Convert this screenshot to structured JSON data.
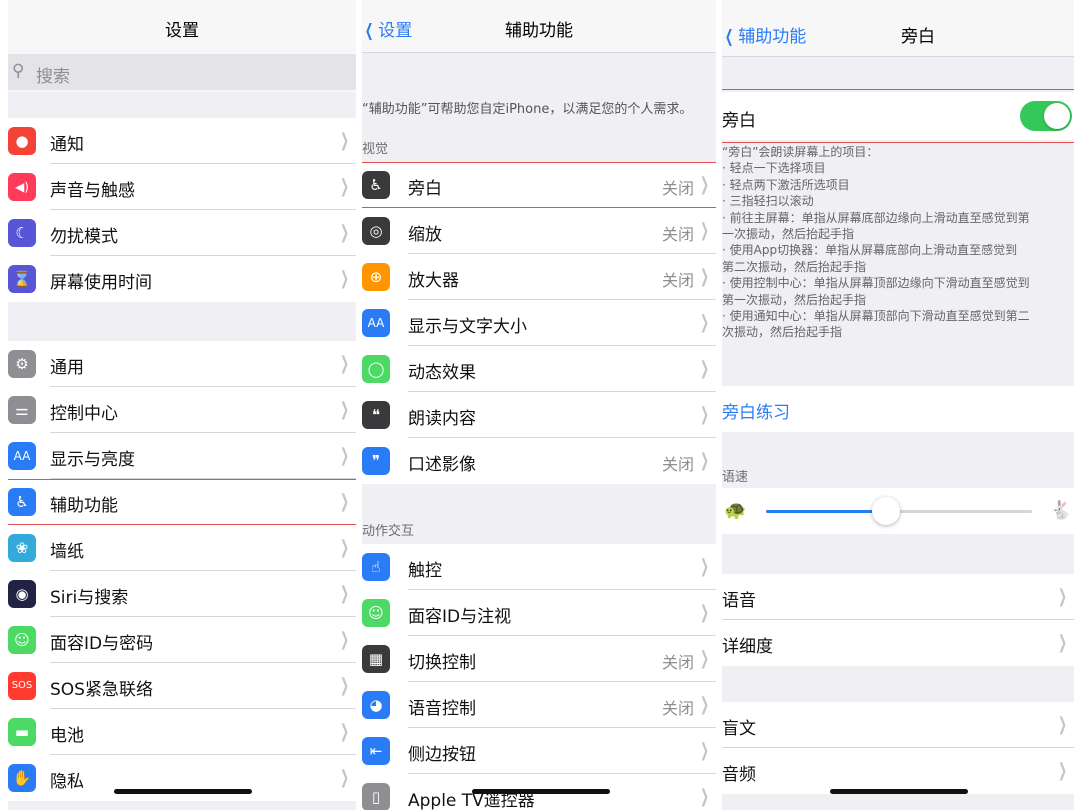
{
  "panel1": {
    "title": "设置",
    "search_placeholder": "搜索",
    "group1": [
      {
        "label": "通知",
        "icon": "notification-icon",
        "color": "#f44336",
        "glyph": "●"
      },
      {
        "label": "声音与触感",
        "icon": "speaker-icon",
        "color": "#ff3b5c",
        "glyph": "◀)"
      },
      {
        "label": "勿扰模式",
        "icon": "moon-icon",
        "color": "#5856d6",
        "glyph": "☾"
      },
      {
        "label": "屏幕使用时间",
        "icon": "hourglass-icon",
        "color": "#5856d6",
        "glyph": "⌛"
      }
    ],
    "group2": [
      {
        "label": "通用",
        "icon": "gear-icon",
        "color": "#8e8e93",
        "glyph": "⚙"
      },
      {
        "label": "控制中心",
        "icon": "switches-icon",
        "color": "#8e8e93",
        "glyph": "⚌"
      },
      {
        "label": "显示与亮度",
        "icon": "text-size-icon",
        "color": "#2a7cf6",
        "glyph": "AA"
      },
      {
        "label": "辅助功能",
        "icon": "accessibility-icon",
        "color": "#2a7cf6",
        "glyph": "♿"
      },
      {
        "label": "墙纸",
        "icon": "flower-icon",
        "color": "#34aadc",
        "glyph": "❀"
      },
      {
        "label": "Siri与搜索",
        "icon": "siri-icon",
        "color": "#222244",
        "glyph": "◉"
      },
      {
        "label": "面容ID与密码",
        "icon": "face-id-icon",
        "color": "#4cd964",
        "glyph": "☺"
      },
      {
        "label": "SOS紧急联络",
        "icon": "sos-icon",
        "color": "#ff3b30",
        "glyph": "SOS"
      },
      {
        "label": "电池",
        "icon": "battery-icon",
        "color": "#4cd964",
        "glyph": "▬"
      },
      {
        "label": "隐私",
        "icon": "hand-icon",
        "color": "#2a7cf6",
        "glyph": "✋"
      }
    ]
  },
  "panel2": {
    "back": "设置",
    "title": "辅助功能",
    "intro": "“辅助功能”可帮助您自定iPhone，以满足您的个人需求。",
    "section_vision": "视觉",
    "vision": [
      {
        "label": "旁白",
        "value": "关闭",
        "icon": "voiceover-icon",
        "color": "#3a3a3c",
        "glyph": "♿"
      },
      {
        "label": "缩放",
        "value": "关闭",
        "icon": "zoom-icon",
        "color": "#3a3a3c",
        "glyph": "◎"
      },
      {
        "label": "放大器",
        "value": "关闭",
        "icon": "magnifier-icon",
        "color": "#ff9500",
        "glyph": "⊕"
      },
      {
        "label": "显示与文字大小",
        "value": "",
        "icon": "text-size-icon",
        "color": "#2a7cf6",
        "glyph": "AA"
      },
      {
        "label": "动态效果",
        "value": "",
        "icon": "motion-icon",
        "color": "#4cd964",
        "glyph": "◯"
      },
      {
        "label": "朗读内容",
        "value": "",
        "icon": "speech-bubble-icon",
        "color": "#3a3a3c",
        "glyph": "❝"
      },
      {
        "label": "口述影像",
        "value": "关闭",
        "icon": "audio-description-icon",
        "color": "#2a7cf6",
        "glyph": "❞"
      }
    ],
    "section_interaction": "动作交互",
    "interaction": [
      {
        "label": "触控",
        "value": "",
        "icon": "touch-hand-icon",
        "color": "#2a7cf6",
        "glyph": "☝"
      },
      {
        "label": "面容ID与注视",
        "value": "",
        "icon": "face-id-icon",
        "color": "#4cd964",
        "glyph": "☺"
      },
      {
        "label": "切换控制",
        "value": "关闭",
        "icon": "grid-icon",
        "color": "#3a3a3c",
        "glyph": "▦"
      },
      {
        "label": "语音控制",
        "value": "关闭",
        "icon": "voice-control-icon",
        "color": "#2a7cf6",
        "glyph": "◕"
      },
      {
        "label": "侧边按钮",
        "value": "",
        "icon": "side-button-icon",
        "color": "#2a7cf6",
        "glyph": "⇤"
      },
      {
        "label": "Apple TV遥控器",
        "value": "",
        "icon": "remote-icon",
        "color": "#8e8e93",
        "glyph": "▯"
      }
    ]
  },
  "panel3": {
    "back": "辅助功能",
    "title": "旁白",
    "toggle_label": "旁白",
    "toggle_on": true,
    "description": [
      "“旁白”会朗读屏幕上的项目：",
      "· 轻点一下选择项目",
      "· 轻点两下激活所选项目",
      "· 三指轻扫以滚动",
      "· 前往主屏幕：单指从屏幕底部边缘向上滑动直至感觉到第",
      "一次振动，然后抬起手指",
      "· 使用App切换器：单指从屏幕底部向上滑动直至感觉到",
      "第二次振动，然后抬起手指",
      "· 使用控制中心：单指从屏幕顶部边缘向下滑动直至感觉到",
      "第一次振动，然后抬起手指",
      "· 使用通知中心：单指从屏幕顶部向下滑动直至感觉到第二",
      "次振动，然后抬起手指"
    ],
    "practice_link": "旁白练习",
    "rate_label": "语速",
    "rate_value": 0.45,
    "rows_a": [
      "语音",
      "详细度"
    ],
    "rows_b": [
      "盲文",
      "音频"
    ]
  },
  "colors": {
    "accent": "#2a7cf6",
    "toggle_on": "#34c759",
    "highlight": "#e05050"
  }
}
